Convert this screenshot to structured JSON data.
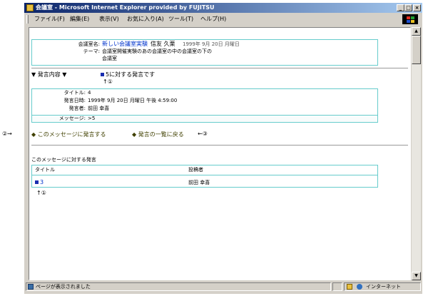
{
  "window": {
    "title": "会議室 - Microsoft Internet Explorer provided by FUJITSU",
    "controls": {
      "minimize": "_",
      "maximize": "□",
      "close": "×"
    }
  },
  "menu": [
    "ファイル(F)",
    "編集(E)",
    "表示(V)",
    "お気に入り(A)",
    "ツール(T)",
    "ヘルプ(H)"
  ],
  "room": {
    "name_label": "会議室名:",
    "name": "新しい会議室実験",
    "author": "信友 久栗",
    "date": "1999年 9月 20日 月曜日",
    "theme_label": "テーマ:",
    "theme_line1": "会議室開催実験のあの会議室の中の会議室の下の",
    "theme_line2": "会議室"
  },
  "content_header": "▼ 発言内容 ▼",
  "reply_to": "5に対する発言です",
  "message": {
    "title_label": "タイトル:",
    "title": "4",
    "datetime_label": "発言日時:",
    "datetime": "1999年 9月 20日 月曜日 午後 4:59:00",
    "poster_label": "発言者:",
    "poster": "前田 幸喜",
    "body_label": "メッセージ:",
    "body": ">5"
  },
  "actions": {
    "reply": "◆ このメッセージに発言する",
    "back": "◆ 発言の一覧に戻る"
  },
  "replies": {
    "heading": "このメッセージに対する発言",
    "columns": [
      "タイトル",
      "投稿者"
    ],
    "rows": [
      {
        "title": "3",
        "poster": "前田 幸喜"
      }
    ]
  },
  "annotations": {
    "marker_one_a": "↑①",
    "marker_one_b": "↑①",
    "marker_two": "②→",
    "marker_three": "←③"
  },
  "status": {
    "text": "ページが表示されました",
    "zone": "インターネット"
  }
}
